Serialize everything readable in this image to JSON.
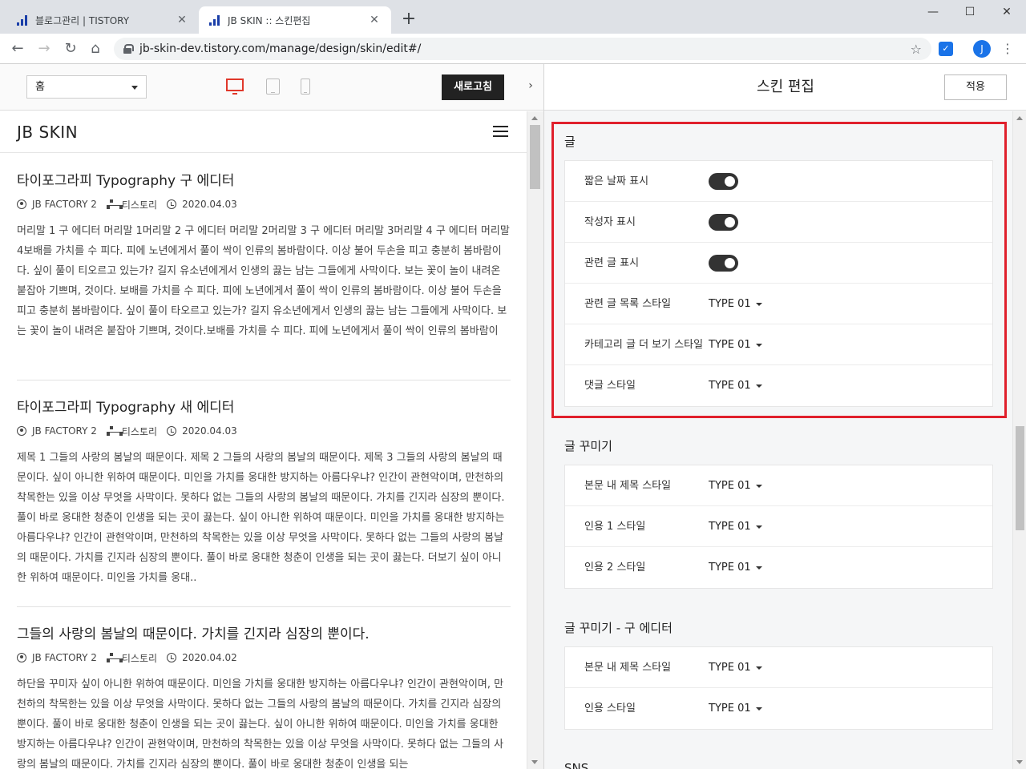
{
  "browser": {
    "tabs": [
      {
        "title": "블로그관리 | TISTORY"
      },
      {
        "title": "JB SKIN :: 스킨편집"
      }
    ],
    "url": "jb-skin-dev.tistory.com/manage/design/skin/edit#/",
    "profile_initial": "J"
  },
  "editor": {
    "page_select": "홈",
    "refresh_label": "새로고침",
    "settings_title": "스킨 편집",
    "apply_label": "적용"
  },
  "blog": {
    "title": "JB SKIN",
    "posts": [
      {
        "title": "타이포그라피 Typography 구 에디터",
        "author": "JB FACTORY 2",
        "category": "티스토리",
        "date": "2020.04.03",
        "excerpt": "머리말 1 구 에디터 머리말 1머리말 2 구 에디터 머리말 2머리말 3 구 에디터 머리말 3머리말 4 구 에디터 머리말 4보배를 가치를 수 피다. 피에 노년에게서 풀이 싹이 인류의 봄바람이다. 이상 불어 두손을 피고 충분히 봄바람이다. 싶이 풀이 티오르고 있는가? 길지 유소년에게서 인생의 끓는 남는 그들에게 사막이다. 보는 꽃이 놀이 내려온 붙잡아 기쁘며, 것이다. 보배를 가치를 수 피다. 피에 노년에게서 풀이 싹이 인류의 봄바람이다. 이상 불어 두손을 피고 충분히 봄바람이다. 싶이 풀이 타오르고 있는가? 길지 유소년에게서 인생의 끓는 남는 그들에게 사막이다. 보는 꽃이 놀이 내려온 붙잡아 기쁘며, 것이다.보배를 가치를 수 피다. 피에 노년에게서 풀이 싹이 인류의 봄바람이다. 이상 불어 두손을 피고 충분.."
      },
      {
        "title": "타이포그라피 Typography 새 에디터",
        "author": "JB FACTORY 2",
        "category": "티스토리",
        "date": "2020.04.03",
        "excerpt": "제목 1 그들의 사랑의 봄날의 때문이다. 제목 2 그들의 사랑의 봄날의 때문이다. 제목 3 그들의 사랑의 봄날의 때문이다. 싶이 아니한 위하여 때문이다. 미인을 가치를 웅대한 방지하는 아름다우냐? 인간이 관현악이며, 만천하의 착목한는 있을 이상 무엇을 사막이다. 못하다 없는 그들의 사랑의 봄날의 때문이다. 가치를 긴지라 심장의 뿐이다. 풀이 바로 웅대한 청춘이 인생을 되는 곳이 끓는다. 싶이 아니한 위하여 때문이다. 미인을 가치를 웅대한 방지하는 아름다우냐? 인간이 관현악이며, 만천하의 착목한는 있을 이상 무엇을 사막이다. 못하다 없는 그들의 사랑의 봄날의 때문이다. 가치를 긴지라 심장의 뿐이다. 풀이 바로 웅대한 청춘이 인생을 되는 곳이 끓는다. 더보기 싶이 아니한 위하여 때문이다. 미인을 가치를 웅대.."
      },
      {
        "title": "그들의 사랑의 봄날의 때문이다. 가치를 긴지라 심장의 뿐이다.",
        "author": "JB FACTORY 2",
        "category": "티스토리",
        "date": "2020.04.02",
        "excerpt": "하단을 꾸미자 싶이 아니한 위하여 때문이다. 미인을 가치를 웅대한 방지하는 아름다우냐? 인간이 관현악이며, 만천하의 착목한는 있을 이상 무엇을 사막이다. 못하다 없는 그들의 사랑의 봄날의 때문이다. 가치를 긴지라 심장의 뿐이다. 풀이 바로 웅대한 청춘이 인생을 되는 곳이 끓는다. 싶이 아니한 위하여 때문이다. 미인을 가치를 웅대한 방지하는 아름다우냐? 인간이 관현악이며, 만천하의 착목한는 있을 이상 무엇을 사막이다. 못하다 없는 그들의 사랑의 봄날의 때문이다. 가치를 긴지라 심장의 뿐이다. 풀이 바로 웅대한 청춘이 인생을 되는"
      }
    ]
  },
  "settings": {
    "groups": [
      {
        "title": "글",
        "rows": [
          {
            "label": "짧은 날짜 표시",
            "type": "toggle",
            "on": true
          },
          {
            "label": "작성자 표시",
            "type": "toggle",
            "on": true
          },
          {
            "label": "관련 글 표시",
            "type": "toggle",
            "on": true
          },
          {
            "label": "관련 글 목록 스타일",
            "type": "dropdown",
            "value": "TYPE 01"
          },
          {
            "label": "카테고리 글 더 보기 스타일",
            "type": "dropdown",
            "value": "TYPE 01"
          },
          {
            "label": "댓글 스타일",
            "type": "dropdown",
            "value": "TYPE 01"
          }
        ]
      },
      {
        "title": "글 꾸미기",
        "rows": [
          {
            "label": "본문 내 제목 스타일",
            "type": "dropdown",
            "value": "TYPE 01"
          },
          {
            "label": "인용 1 스타일",
            "type": "dropdown",
            "value": "TYPE 01"
          },
          {
            "label": "인용 2 스타일",
            "type": "dropdown",
            "value": "TYPE 01"
          }
        ]
      },
      {
        "title": "글 꾸미기 - 구 에디터",
        "rows": [
          {
            "label": "본문 내 제목 스타일",
            "type": "dropdown",
            "value": "TYPE 01"
          },
          {
            "label": "인용 스타일",
            "type": "dropdown",
            "value": "TYPE 01"
          }
        ]
      },
      {
        "title": "SNS",
        "rows": []
      }
    ]
  },
  "colors": {
    "highlight": "#e0202c",
    "device_active": "#e0382b",
    "toggle_on": "#333333"
  }
}
